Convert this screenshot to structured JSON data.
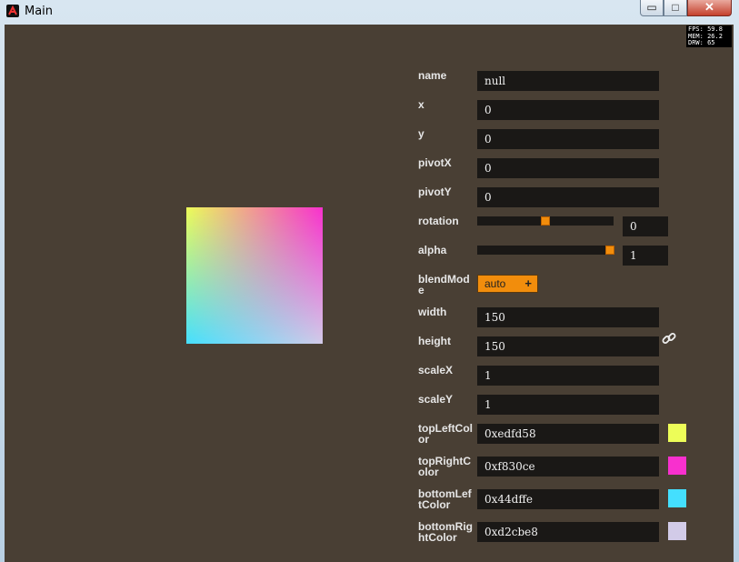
{
  "window": {
    "title": "Main",
    "minimize_glyph": "▭",
    "maximize_glyph": "□",
    "close_glyph": "✕"
  },
  "stats": [
    "FPS: 59.8",
    "MEM: 26.2",
    "DRW: 65"
  ],
  "props": [
    {
      "label": "name",
      "value": "null"
    },
    {
      "label": "x",
      "value": "0"
    },
    {
      "label": "y",
      "value": "0"
    },
    {
      "label": "pivotX",
      "value": "0"
    },
    {
      "label": "pivotY",
      "value": "0"
    },
    {
      "label": "rotation",
      "value": "0",
      "slider_fraction": 0.5
    },
    {
      "label": "alpha",
      "value": "1",
      "slider_fraction": 0.97
    },
    {
      "label": "blendMode",
      "value": "auto",
      "button_glyph": "+"
    },
    {
      "label": "width",
      "value": "150"
    },
    {
      "label": "height",
      "value": "150"
    },
    {
      "label": "scaleX",
      "value": "1"
    },
    {
      "label": "scaleY",
      "value": "1"
    },
    {
      "label": "topLeftColor",
      "value": "0xedfd58",
      "color": "#edfd58"
    },
    {
      "label": "topRightColor",
      "value": "0xf830ce",
      "color": "#f830ce"
    },
    {
      "label": "bottomLeftColor",
      "value": "0x44dffe",
      "color": "#44dffe"
    },
    {
      "label": "bottomRightColor",
      "value": "0xd2cbe8",
      "color": "#d2cbe8"
    }
  ],
  "icons": {
    "app": "app-logo-icon",
    "link": "link-icon"
  }
}
